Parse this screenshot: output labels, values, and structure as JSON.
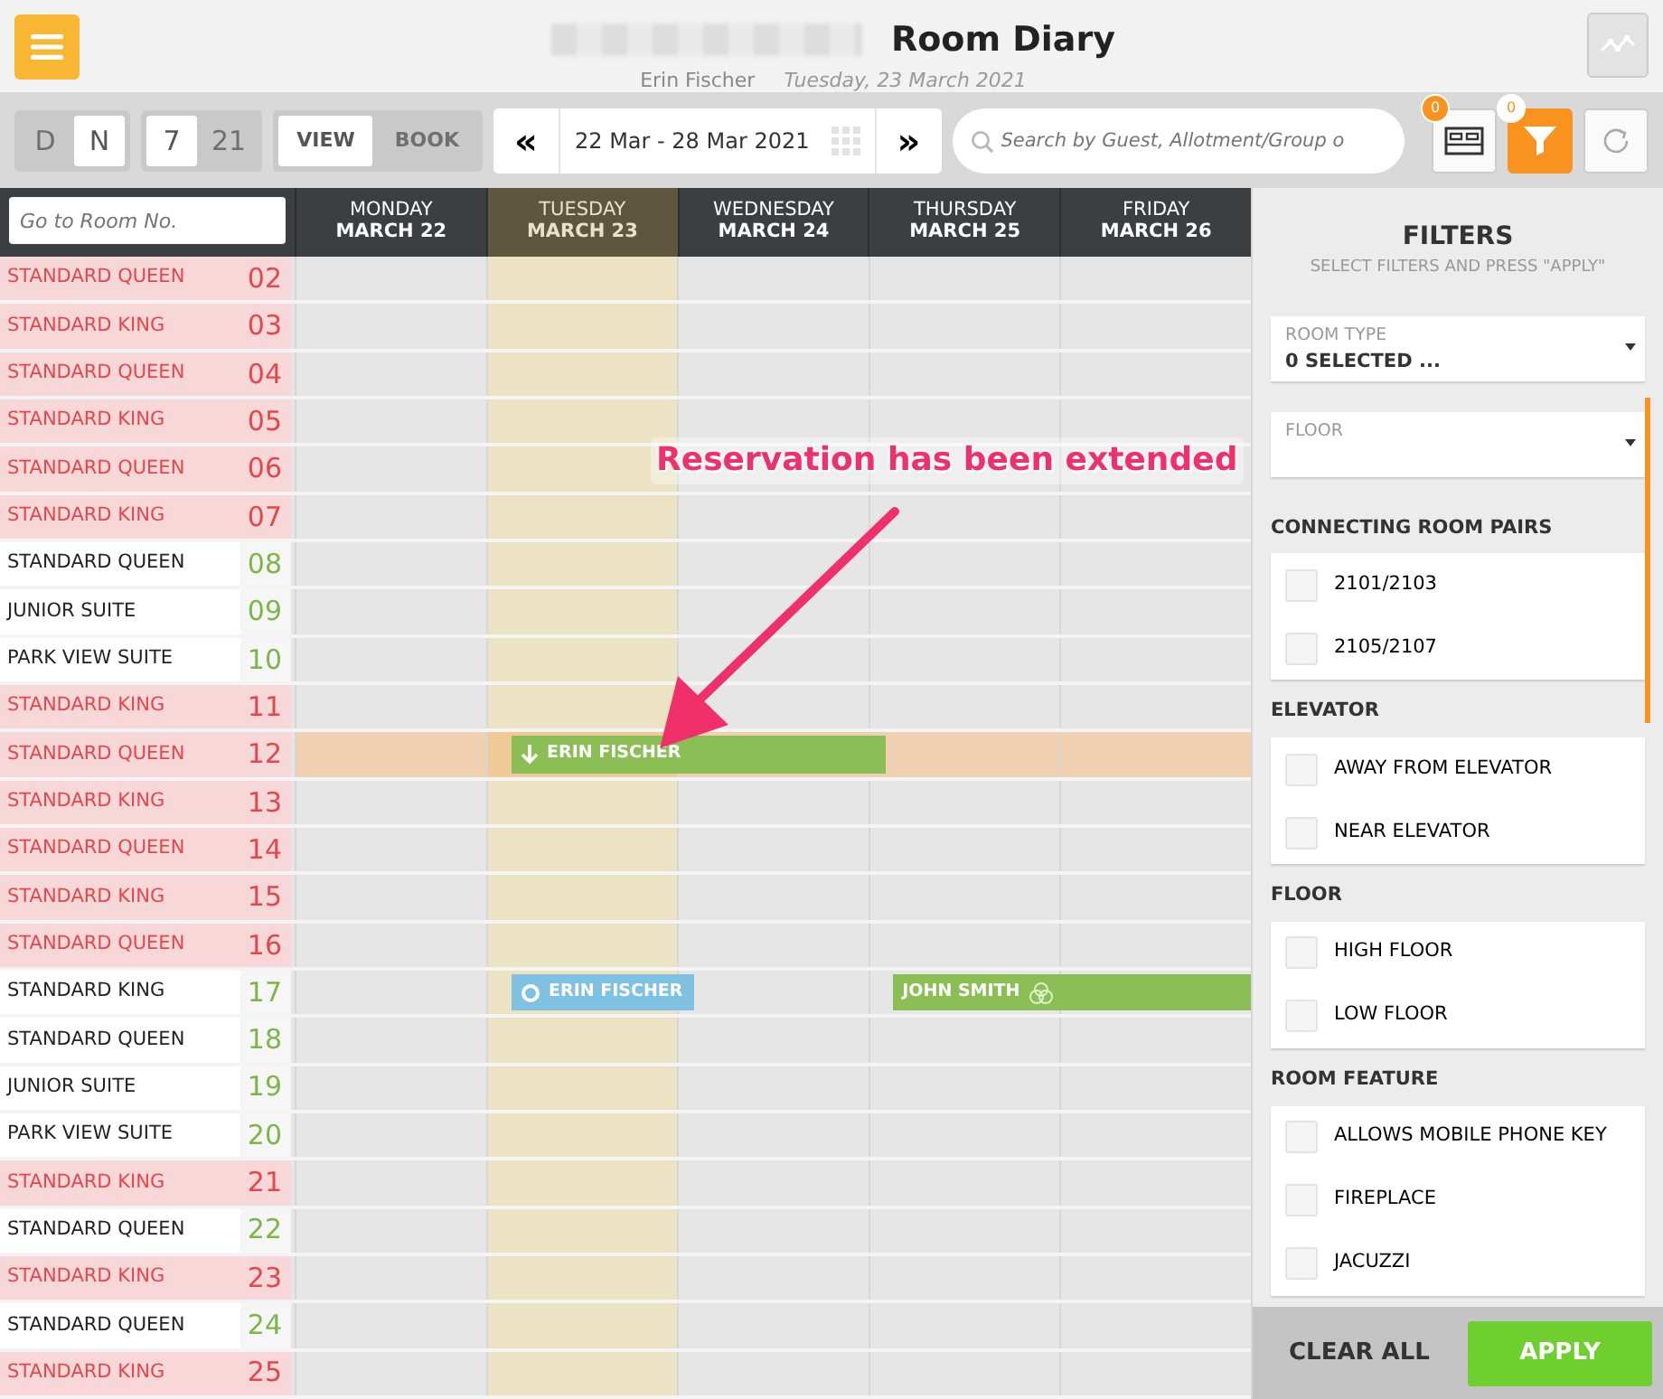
{
  "header": {
    "title": "Room Diary",
    "user": "Erin Fischer",
    "date": "Tuesday, 23 March 2021"
  },
  "toolbar": {
    "shift": [
      {
        "label": "D",
        "selected": false
      },
      {
        "label": "N",
        "selected": true
      }
    ],
    "range": [
      {
        "label": "7",
        "selected": true
      },
      {
        "label": "21",
        "selected": false
      }
    ],
    "mode": [
      {
        "label": "VIEW",
        "selected": true
      },
      {
        "label": "BOOK",
        "selected": false
      }
    ],
    "prev": "«",
    "period": "22 Mar - 28 Mar 2021",
    "next": "»",
    "search": {
      "placeholder": "Search by Guest, Allotment/Group o"
    },
    "rooms_badge": "0",
    "filter_badge": "0",
    "filter_active": true
  },
  "room_search": {
    "placeholder": "Go to Room No."
  },
  "days": [
    {
      "weekday": "MONDAY",
      "date": "MARCH 22",
      "today": false
    },
    {
      "weekday": "TUESDAY",
      "date": "MARCH 23",
      "today": true
    },
    {
      "weekday": "WEDNESDAY",
      "date": "MARCH 24",
      "today": false
    },
    {
      "weekday": "THURSDAY",
      "date": "MARCH 25",
      "today": false
    },
    {
      "weekday": "FRIDAY",
      "date": "MARCH 26",
      "today": false
    }
  ],
  "rooms": [
    {
      "type": "STANDARD QUEEN",
      "number": "02",
      "dirty": true
    },
    {
      "type": "STANDARD KING",
      "number": "03",
      "dirty": true
    },
    {
      "type": "STANDARD QUEEN",
      "number": "04",
      "dirty": true
    },
    {
      "type": "STANDARD KING",
      "number": "05",
      "dirty": true
    },
    {
      "type": "STANDARD QUEEN",
      "number": "06",
      "dirty": true
    },
    {
      "type": "STANDARD KING",
      "number": "07",
      "dirty": true
    },
    {
      "type": "STANDARD QUEEN",
      "number": "08",
      "dirty": false
    },
    {
      "type": "JUNIOR SUITE",
      "number": "09",
      "dirty": false
    },
    {
      "type": "PARK VIEW SUITE",
      "number": "10",
      "dirty": false
    },
    {
      "type": "STANDARD KING",
      "number": "11",
      "dirty": true
    },
    {
      "type": "STANDARD QUEEN",
      "number": "12",
      "dirty": true,
      "highlighted": true,
      "bookings": [
        {
          "guest": "ERIN FISCHER",
          "kind": "extended",
          "color": "#8bbf56"
        }
      ]
    },
    {
      "type": "STANDARD KING",
      "number": "13",
      "dirty": true
    },
    {
      "type": "STANDARD QUEEN",
      "number": "14",
      "dirty": true
    },
    {
      "type": "STANDARD KING",
      "number": "15",
      "dirty": true
    },
    {
      "type": "STANDARD QUEEN",
      "number": "16",
      "dirty": true
    },
    {
      "type": "STANDARD KING",
      "number": "17",
      "dirty": false,
      "bookings": [
        {
          "guest": "ERIN FISCHER",
          "kind": "arriving",
          "color": "#7fc1e0"
        },
        {
          "guest": "JOHN SMITH",
          "kind": "group",
          "color": "#8bbf56"
        }
      ]
    },
    {
      "type": "STANDARD QUEEN",
      "number": "18",
      "dirty": false
    },
    {
      "type": "JUNIOR SUITE",
      "number": "19",
      "dirty": false
    },
    {
      "type": "PARK VIEW SUITE",
      "number": "20",
      "dirty": false
    },
    {
      "type": "STANDARD KING",
      "number": "21",
      "dirty": true
    },
    {
      "type": "STANDARD QUEEN",
      "number": "22",
      "dirty": false
    },
    {
      "type": "STANDARD KING",
      "number": "23",
      "dirty": true
    },
    {
      "type": "STANDARD QUEEN",
      "number": "24",
      "dirty": false
    },
    {
      "type": "STANDARD KING",
      "number": "25",
      "dirty": true
    }
  ],
  "annotation": "Reservation has been extended",
  "filters": {
    "title": "FILTERS",
    "subtitle": "SELECT FILTERS AND PRESS \"APPLY\"",
    "dropdowns": [
      {
        "label": "ROOM TYPE",
        "value": "0 SELECTED ..."
      },
      {
        "label": "FLOOR"
      }
    ],
    "groups": [
      {
        "title": "CONNECTING ROOM PAIRS",
        "items": [
          {
            "label": "2101/2103",
            "checked": false
          },
          {
            "label": "2105/2107",
            "checked": false
          }
        ]
      },
      {
        "title": "ELEVATOR",
        "items": [
          {
            "label": "AWAY FROM ELEVATOR",
            "checked": false
          },
          {
            "label": "NEAR ELEVATOR",
            "checked": false
          }
        ]
      },
      {
        "title": "FLOOR",
        "items": [
          {
            "label": "HIGH FLOOR",
            "checked": false
          },
          {
            "label": "LOW FLOOR",
            "checked": false
          }
        ]
      },
      {
        "title": "ROOM FEATURE",
        "items": [
          {
            "label": "ALLOWS MOBILE PHONE KEY",
            "checked": false
          },
          {
            "label": "FIREPLACE",
            "checked": false
          },
          {
            "label": "JACUZZI",
            "checked": false
          }
        ]
      }
    ],
    "clear": "CLEAR ALL",
    "apply": "APPLY"
  }
}
